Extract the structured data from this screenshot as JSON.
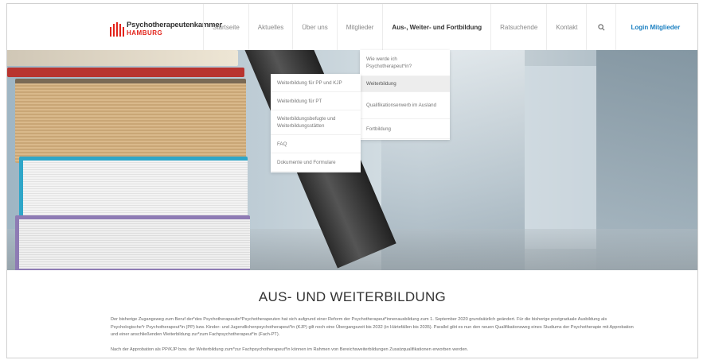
{
  "header": {
    "logo_line1": "Psychotherapeutenkammer",
    "logo_line2": "HAMBURG",
    "nav": [
      "Startseite",
      "Aktuelles",
      "Über uns",
      "Mitglieder",
      "Aus-, Weiter- und Fortbildung",
      "Ratsuchende",
      "Kontakt"
    ],
    "search_icon": "search-icon",
    "login": "Login Mitglieder"
  },
  "dropdown_main": [
    "Wie werde ich Psychotherapeut*in?",
    "Weiterbildung",
    "Qualifikationserwerb im Ausland",
    "Fortbildung"
  ],
  "dropdown_sub": [
    "Weiterbildung für PP und KJP",
    "Weiterbildung für PT",
    "Weiterbildungsbefugte und Weiterbildungsstätten",
    "FAQ",
    "Dokumente und Formulare"
  ],
  "content": {
    "title": "AUS- UND WEITERBILDUNG",
    "para1": "Der bisherige Zugangsweg zum Beruf der*des Psychotherapeutin*Psychotherapeuten hat sich aufgrund einer Reform der Psychotherapeut*innenausbildung zum 1. September 2020 grundsätzlich geändert. Für die bisherige postgraduale Ausbildung als Psychologische*r Psychotherapeut*in (PP) bzw. Kinder- und Jugendlichenpsychotherapeut*in (KJP) gilt noch eine Übergangszeit bis 2032 (in Härtefällen bis 2035). Parallel gibt es nun den neuen Qualifikationsweg eines Studiums der Psychotherapie mit Approbation und einer anschließenden Weiterbildung zur*zum Fachpsychotherapeut*in (Fach-PT).",
    "para2": "Nach der Approbation als PP/KJP bzw. der Weiterbildung zum*zur Fachpsychotherapeut*in können im Rahmen von Bereichsweiterbildungen Zusatzqualifikationen erworben werden."
  },
  "colors": {
    "brand_red": "#e2231a",
    "link_blue": "#1a7fc1"
  }
}
